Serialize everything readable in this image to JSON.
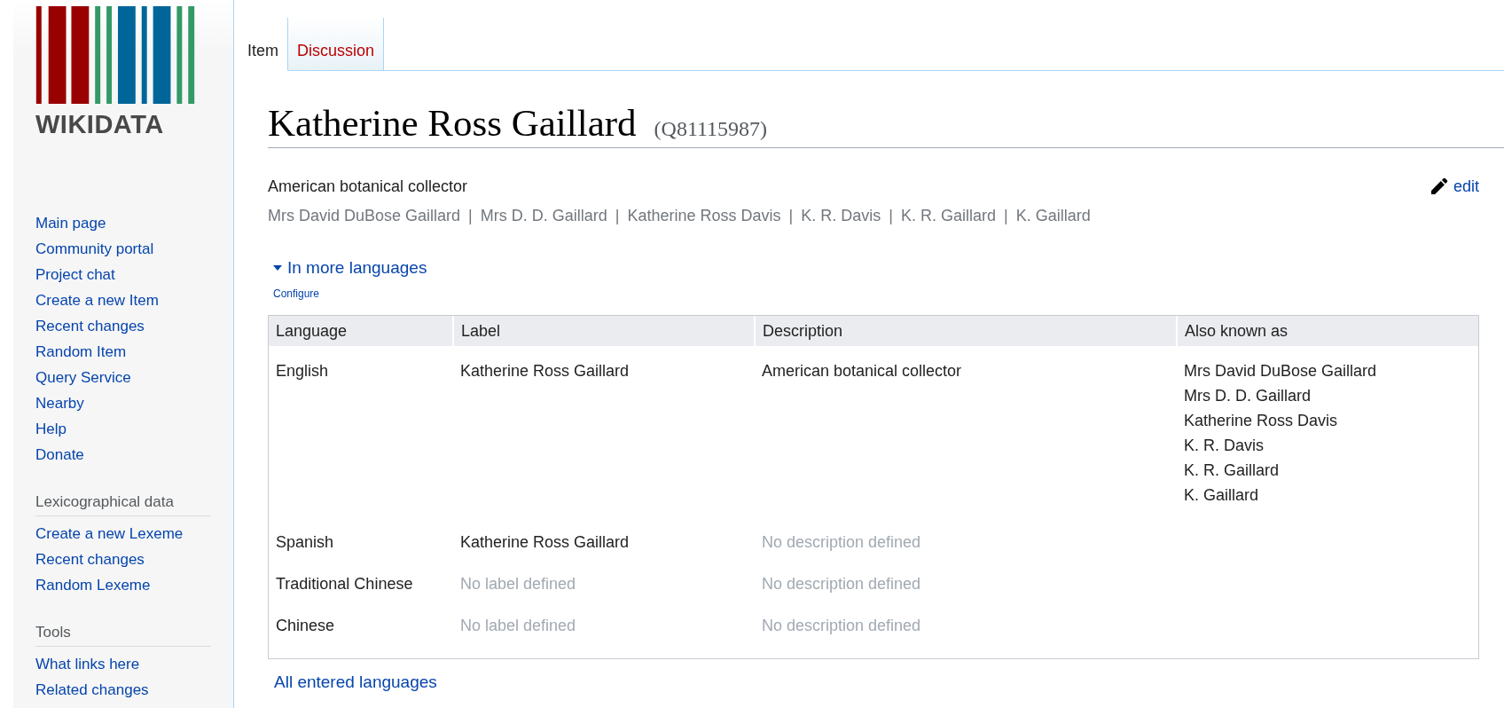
{
  "logo": {
    "wordmark": "WIKIDATA"
  },
  "sidebar": {
    "navigation": [
      {
        "label": "Main page"
      },
      {
        "label": "Community portal"
      },
      {
        "label": "Project chat"
      },
      {
        "label": "Create a new Item"
      },
      {
        "label": "Recent changes"
      },
      {
        "label": "Random Item"
      },
      {
        "label": "Query Service"
      },
      {
        "label": "Nearby"
      },
      {
        "label": "Help"
      },
      {
        "label": "Donate"
      }
    ],
    "sections": [
      {
        "heading": "Lexicographical data",
        "items": [
          {
            "label": "Create a new Lexeme"
          },
          {
            "label": "Recent changes"
          },
          {
            "label": "Random Lexeme"
          }
        ]
      },
      {
        "heading": "Tools",
        "items": [
          {
            "label": "What links here"
          },
          {
            "label": "Related changes"
          }
        ]
      }
    ]
  },
  "tabs": [
    {
      "label": "Item",
      "selected": true,
      "missing": false
    },
    {
      "label": "Discussion",
      "selected": false,
      "missing": true
    }
  ],
  "heading": {
    "label": "Katherine Ross Gaillard",
    "id": "(Q81115987)"
  },
  "description": "American botanical collector",
  "aliases": {
    "separator": "|",
    "items": [
      "Mrs David DuBose Gaillard",
      "Mrs D. D. Gaillard",
      "Katherine Ross Davis",
      "K. R. Davis",
      "K. R. Gaillard",
      "K. Gaillard"
    ]
  },
  "edit_link": "edit",
  "languages_toggle": {
    "label": "In more languages",
    "expanded": true
  },
  "configure_link": "Configure",
  "terms_table": {
    "columns": [
      "Language",
      "Label",
      "Description",
      "Also known as"
    ],
    "rows": [
      {
        "language": "English",
        "label": {
          "text": "Katherine Ross Gaillard",
          "defined": true
        },
        "description": {
          "text": "American botanical collector",
          "defined": true
        },
        "aliases": [
          "Mrs David DuBose Gaillard",
          "Mrs D. D. Gaillard",
          "Katherine Ross Davis",
          "K. R. Davis",
          "K. R. Gaillard",
          "K. Gaillard"
        ]
      },
      {
        "language": "Spanish",
        "label": {
          "text": "Katherine Ross Gaillard",
          "defined": true
        },
        "description": {
          "text": "No description defined",
          "defined": false
        },
        "aliases": []
      },
      {
        "language": "Traditional Chinese",
        "label": {
          "text": "No label defined",
          "defined": false
        },
        "description": {
          "text": "No description defined",
          "defined": false
        },
        "aliases": []
      },
      {
        "language": "Chinese",
        "label": {
          "text": "No label defined",
          "defined": false
        },
        "description": {
          "text": "No description defined",
          "defined": false
        },
        "aliases": []
      }
    ]
  },
  "all_languages_link": "All entered languages"
}
